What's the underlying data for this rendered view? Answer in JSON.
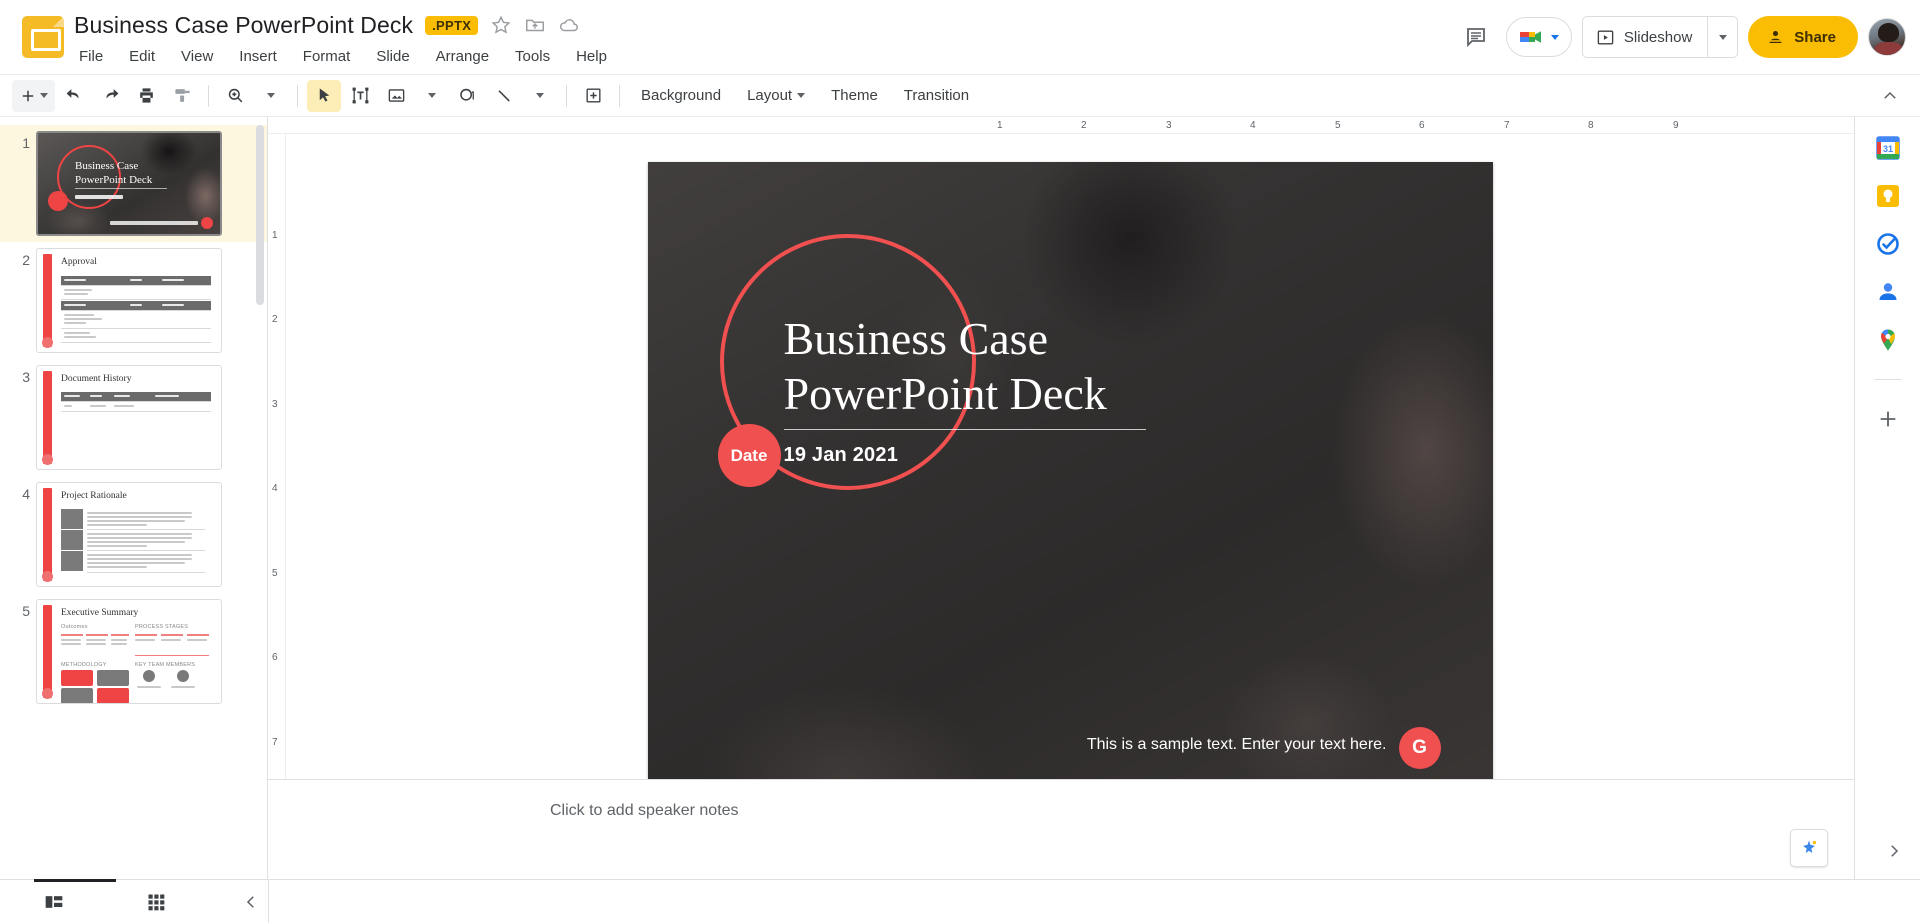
{
  "app": {
    "doc_title": "Business Case  PowerPoint Deck",
    "file_badge": ".PPTX",
    "doc_icon": "slides-icon"
  },
  "menu": {
    "items": [
      "File",
      "Edit",
      "View",
      "Insert",
      "Format",
      "Slide",
      "Arrange",
      "Tools",
      "Help"
    ]
  },
  "top_right": {
    "comment_icon": "comment-icon",
    "meet_icon": "google-meet-icon",
    "slideshow_label": "Slideshow",
    "share_label": "Share",
    "avatar_label": "account-avatar"
  },
  "toolbar": {
    "new_slide": "add-slide",
    "undo": "undo",
    "redo": "redo",
    "print": "print",
    "paint_format": "paint-format",
    "zoom": "zoom",
    "select": "select-tool",
    "text_box": "text-box",
    "image": "insert-image",
    "shape": "insert-shape",
    "line": "insert-line",
    "table": "insert-table",
    "background_label": "Background",
    "layout_label": "Layout",
    "theme_label": "Theme",
    "transition_label": "Transition",
    "collapse": "collapse-toolbar"
  },
  "filmstrip": {
    "slides": [
      {
        "number": "1",
        "title": "Business Case PowerPoint Deck",
        "date": "19 Jan 2021",
        "type": "title",
        "selected": true
      },
      {
        "number": "2",
        "title": "Approval",
        "type": "table",
        "selected": false
      },
      {
        "number": "3",
        "title": "Document History",
        "type": "table-small",
        "selected": false
      },
      {
        "number": "4",
        "title": "Project Rationale",
        "type": "rows",
        "selected": false
      },
      {
        "number": "5",
        "title": "Executive Summary",
        "type": "summary",
        "selected": false
      }
    ],
    "slide5_sections": [
      "Outcomes",
      "PROCESS STAGES",
      "METHODOLOGY",
      "KEY TEAM MEMBERS"
    ]
  },
  "rulers": {
    "horizontal": [
      "1",
      "2",
      "3",
      "4",
      "5",
      "6",
      "7",
      "8",
      "9"
    ],
    "vertical": [
      "1",
      "2",
      "3",
      "4",
      "5",
      "6",
      "7"
    ]
  },
  "slide": {
    "title_line1": "Business Case",
    "title_line2": "PowerPoint Deck",
    "date_badge": "Date",
    "date_value": "19 Jan 2021",
    "footer_text": "This is a sample text. Enter your text here.",
    "footer_badge": "G",
    "accent_color": "#f0504f"
  },
  "notes": {
    "placeholder": "Click to add speaker notes",
    "explore_icon": "explore-icon"
  },
  "right_rail": {
    "icons": [
      {
        "name": "google-calendar-icon",
        "label": "31"
      },
      {
        "name": "google-keep-icon",
        "label": ""
      },
      {
        "name": "google-tasks-icon",
        "label": ""
      },
      {
        "name": "google-contacts-icon",
        "label": ""
      },
      {
        "name": "google-maps-icon",
        "label": ""
      }
    ],
    "add_on_label": "+",
    "expand_icon": "expand-panel-icon"
  },
  "bottom_bar": {
    "filmstrip_view": "filmstrip-view-icon",
    "grid_view": "grid-view-icon",
    "collapse": "collapse-filmstrip-icon"
  }
}
